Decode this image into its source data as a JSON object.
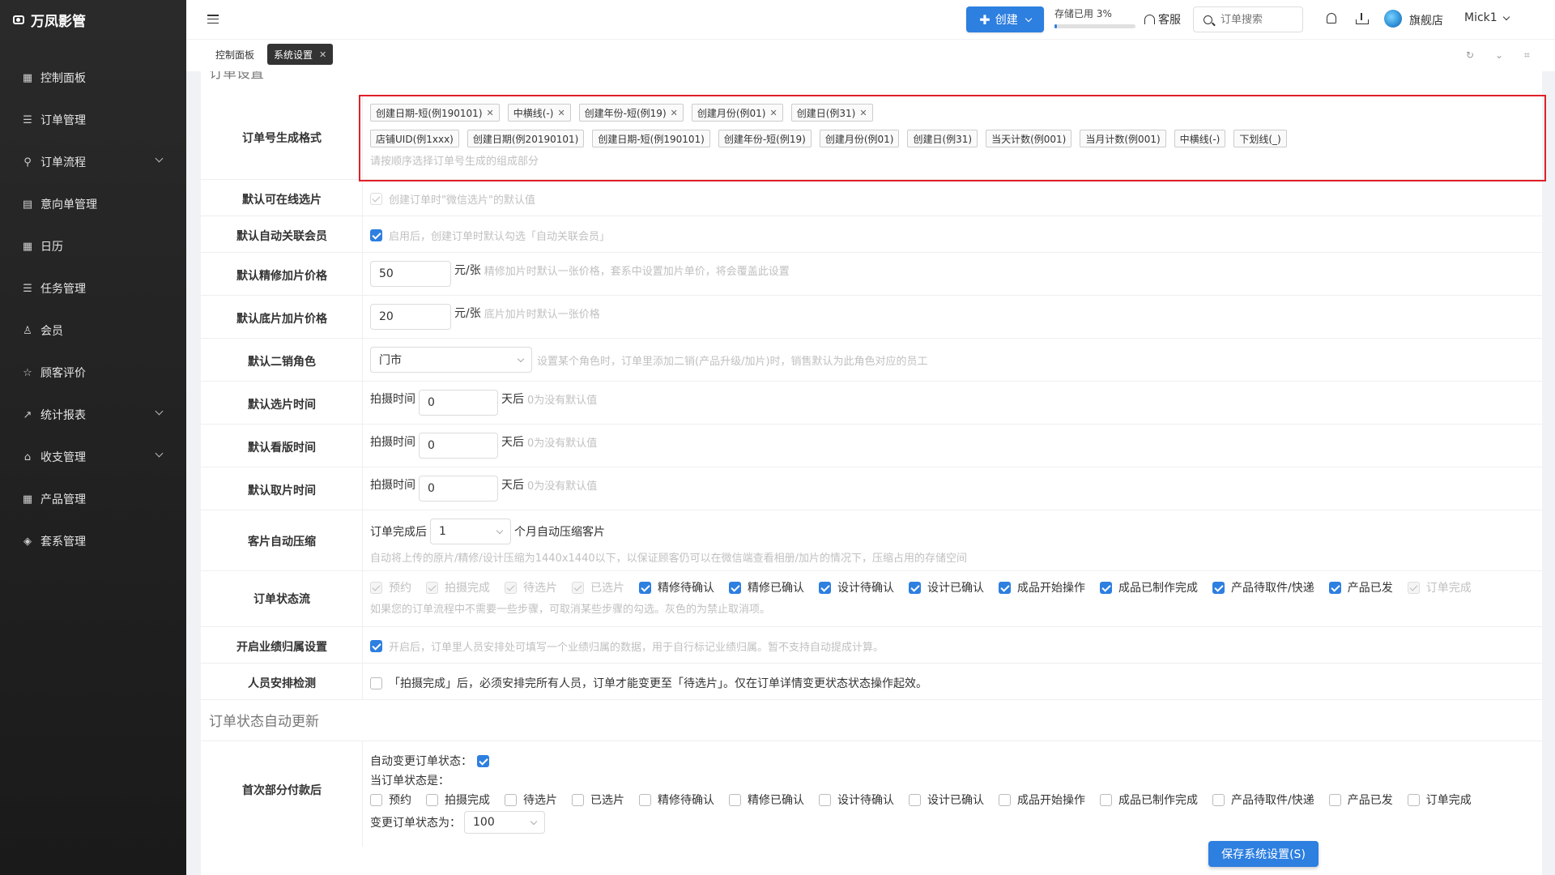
{
  "brand": {
    "name": "万凤影管"
  },
  "sidebar": {
    "items": [
      {
        "label": "控制面板",
        "icon": "grid-icon",
        "glyph": "▦",
        "expandable": false
      },
      {
        "label": "订单管理",
        "icon": "list-icon",
        "glyph": "☰",
        "expandable": false
      },
      {
        "label": "订单流程",
        "icon": "flow-icon",
        "glyph": "⚲",
        "expandable": true
      },
      {
        "label": "意向单管理",
        "icon": "doc-icon",
        "glyph": "▤",
        "expandable": false
      },
      {
        "label": "日历",
        "icon": "calendar-icon",
        "glyph": "▦",
        "expandable": false
      },
      {
        "label": "任务管理",
        "icon": "task-icon",
        "glyph": "☰",
        "expandable": false
      },
      {
        "label": "会员",
        "icon": "user-icon",
        "glyph": "♙",
        "expandable": false
      },
      {
        "label": "顾客评价",
        "icon": "star-icon",
        "glyph": "☆",
        "expandable": false
      },
      {
        "label": "统计报表",
        "icon": "chart-icon",
        "glyph": "↗",
        "expandable": true
      },
      {
        "label": "收支管理",
        "icon": "bank-icon",
        "glyph": "⌂",
        "expandable": true
      },
      {
        "label": "产品管理",
        "icon": "product-icon",
        "glyph": "▦",
        "expandable": false
      },
      {
        "label": "套系管理",
        "icon": "package-icon",
        "glyph": "◈",
        "expandable": false
      }
    ]
  },
  "header": {
    "create_label": "创建",
    "storage_label": "存储已用 3%",
    "storage_percent": 3,
    "support_label": "客服",
    "search_placeholder": "订单搜索",
    "shop_label": "旗舰店",
    "user_name": "Mick1"
  },
  "tabs": [
    {
      "label": "控制面板",
      "active": false
    },
    {
      "label": "系统设置",
      "active": true
    }
  ],
  "settings": {
    "section1_title": "订单设置",
    "order_format": {
      "label": "订单号生成格式",
      "selected": [
        "创建日期-短(例190101)",
        "中横线(-)",
        "创建年份-短(例19)",
        "创建月份(例01)",
        "创建日(例31)"
      ],
      "options": [
        "店铺UID(例1xxx)",
        "创建日期(例20190101)",
        "创建日期-短(例190101)",
        "创建年份-短(例19)",
        "创建月份(例01)",
        "创建日(例31)",
        "当天计数(例001)",
        "当月计数(例001)",
        "中横线(-)",
        "下划线(_)"
      ],
      "hint": "请按顺序选择订单号生成的组成部分"
    },
    "online_select": {
      "label": "默认可在线选片",
      "checked": false,
      "hint": "创建订单时\"微信选片\"的默认值"
    },
    "auto_member": {
      "label": "默认自动关联会员",
      "checked": true,
      "hint": "启用后，创建订单时默认勾选「自动关联会员」"
    },
    "retouch_price": {
      "label": "默认精修加片价格",
      "value": "50",
      "unit": "元/张",
      "hint": "精修加片时默认一张价格，套系中设置加片单价，将会覆盖此设置"
    },
    "raw_price": {
      "label": "默认底片加片价格",
      "value": "20",
      "unit": "元/张",
      "hint": "底片加片时默认一张价格"
    },
    "second_sales": {
      "label": "默认二销角色",
      "value": "门市",
      "hint": "设置某个角色时，订单里添加二销(产品升级/加片)时，销售默认为此角色对应的员工"
    },
    "select_time": {
      "label": "默认选片时间",
      "prefix": "拍摄时间",
      "value": "0",
      "suffix": "天后",
      "hint": "0为没有默认值"
    },
    "proof_time": {
      "label": "默认看版时间",
      "prefix": "拍摄时间",
      "value": "0",
      "suffix": "天后",
      "hint": "0为没有默认值"
    },
    "pickup_time": {
      "label": "默认取片时间",
      "prefix": "拍摄时间",
      "value": "0",
      "suffix": "天后",
      "hint": "0为没有默认值"
    },
    "compress": {
      "label": "客片自动压缩",
      "prefix": "订单完成后",
      "value": "1",
      "suffix": "个月自动压缩客片",
      "hint": "自动将上传的原片/精修/设计压缩为1440x1440以下，以保证顾客仍可以在微信端查看相册/加片的情况下，压缩占用的存储空间"
    },
    "status_flow": {
      "label": "订单状态流",
      "items": [
        {
          "label": "预约",
          "state": "disabled"
        },
        {
          "label": "拍摄完成",
          "state": "disabled"
        },
        {
          "label": "待选片",
          "state": "disabled"
        },
        {
          "label": "已选片",
          "state": "disabled"
        },
        {
          "label": "精修待确认",
          "state": "on"
        },
        {
          "label": "精修已确认",
          "state": "on"
        },
        {
          "label": "设计待确认",
          "state": "on"
        },
        {
          "label": "设计已确认",
          "state": "on"
        },
        {
          "label": "成品开始操作",
          "state": "on"
        },
        {
          "label": "成品已制作完成",
          "state": "on"
        },
        {
          "label": "产品待取件/快递",
          "state": "on"
        },
        {
          "label": "产品已发",
          "state": "on"
        },
        {
          "label": "订单完成",
          "state": "disabled"
        }
      ],
      "hint": "如果您的订单流程中不需要一些步骤，可取消某些步骤的勾选。灰色的为禁止取消项。"
    },
    "performance": {
      "label": "开启业绩归属设置",
      "checked": true,
      "hint": "开启后，订单里人员安排处可填写一个业绩归属的数据，用于自行标记业绩归属。暂不支持自动提成计算。"
    },
    "staff_check": {
      "label": "人员安排检测",
      "checked": false,
      "text": "「拍摄完成」后，必须安排完所有人员，订单才能变更至「待选片」。仅在订单详情变更状态状态操作起效。"
    },
    "section2_title": "订单状态自动更新",
    "first_payment": {
      "label": "首次部分付款后",
      "auto_label": "自动变更订单状态：",
      "auto_checked": true,
      "current_label": "当订单状态是：",
      "statuses": [
        "预约",
        "拍摄完成",
        "待选片",
        "已选片",
        "精修待确认",
        "精修已确认",
        "设计待确认",
        "设计已确认",
        "成品开始操作",
        "成品已制作完成",
        "产品待取件/快递",
        "产品已发",
        "订单完成"
      ],
      "change_label": "变更订单状态为：",
      "change_value": "100"
    }
  },
  "save_label": "保存系统设置(S)",
  "colors": {
    "accent": "#2d7fe0",
    "highlight_box": "#e0202a",
    "sidebar_bg": "#222222"
  }
}
